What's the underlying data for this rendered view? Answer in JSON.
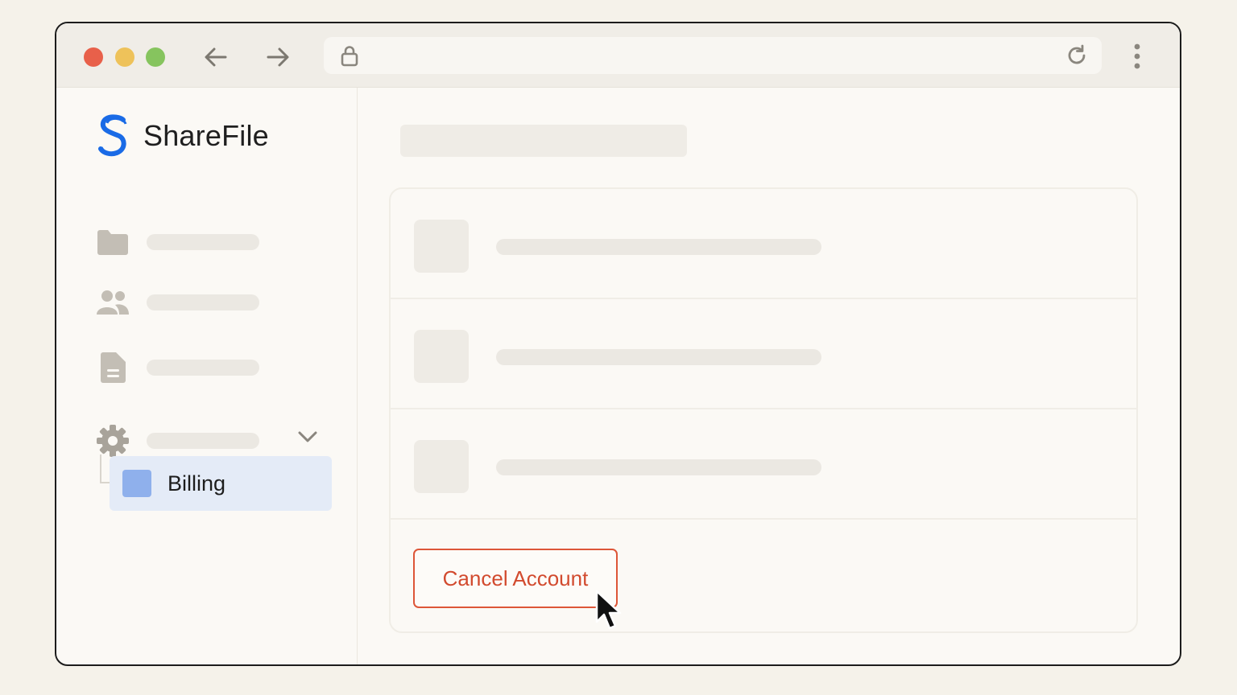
{
  "browser": {
    "traffic_lights": {
      "close": "#e8604a",
      "minimize": "#eec25a",
      "maximize": "#86c45e"
    },
    "icons": {
      "back": "arrow-left",
      "forward": "arrow-right",
      "lock": "lock",
      "reload": "reload",
      "menu": "kebab-vertical"
    }
  },
  "sidebar": {
    "brand": {
      "name": "ShareFile",
      "logo_color": "#1a6be6"
    },
    "items": [
      {
        "icon": "folder-icon"
      },
      {
        "icon": "users-icon"
      },
      {
        "icon": "document-icon"
      },
      {
        "icon": "gear-icon",
        "expanded": true
      }
    ],
    "sub_item": {
      "label": "Billing",
      "selected": true,
      "accent": "#8fb0ec",
      "background": "#e4ebf7"
    }
  },
  "main": {
    "rows": [
      {},
      {},
      {}
    ],
    "cancel_button": {
      "label": "Cancel Account",
      "color": "#dd5638"
    }
  }
}
